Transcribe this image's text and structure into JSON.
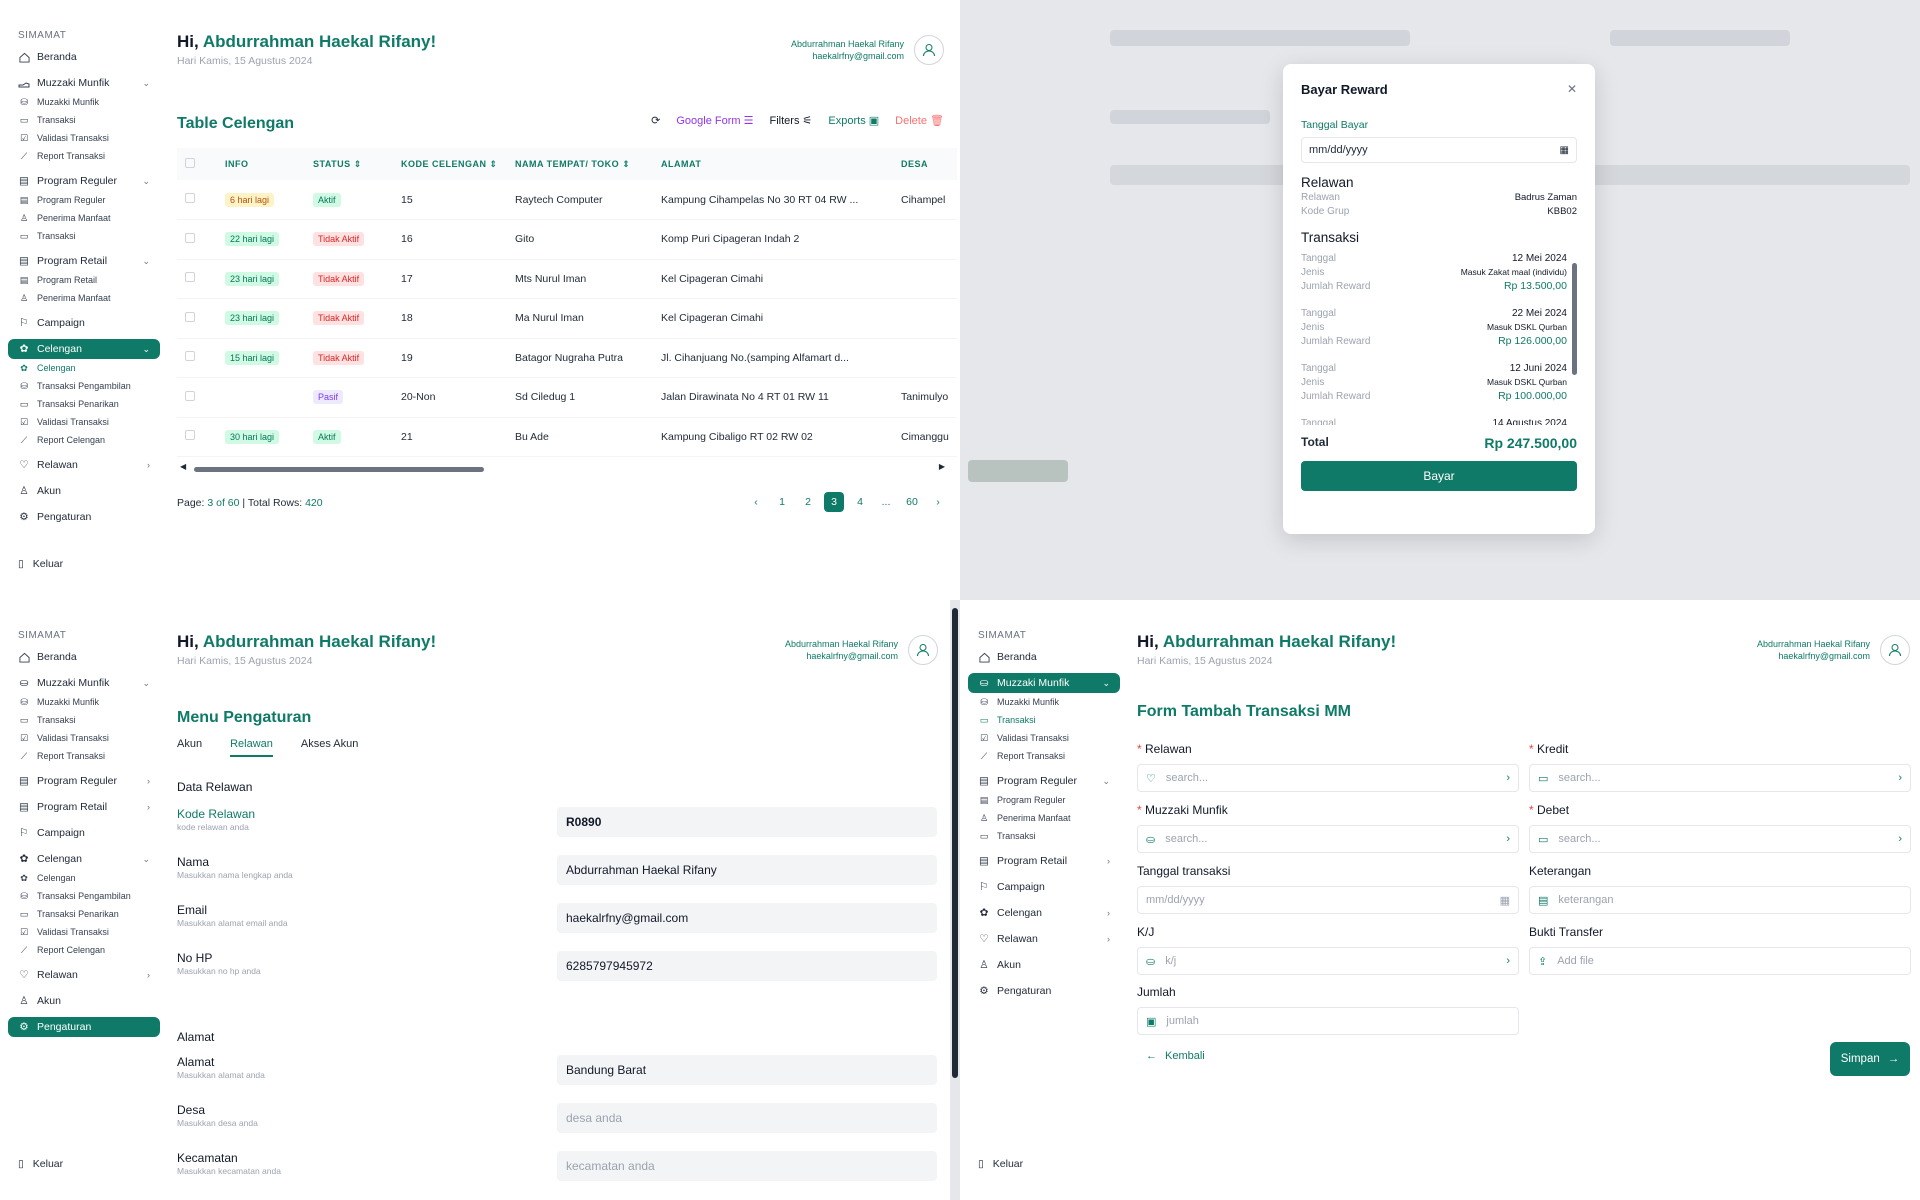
{
  "brand": "SIMAMAT",
  "header": {
    "greeting": "Hi,",
    "name": "Abdurrahman Haekal Rifany!",
    "date": "Hari Kamis, 15 Agustus 2024",
    "user_name": "Abdurrahman Haekal Rifany",
    "user_email": "haekalrfny@gmail.com"
  },
  "nav": {
    "beranda": "Beranda",
    "muzzaki": "Muzzaki Munfik",
    "muzzaki_sub": [
      "Muzakki Munfik",
      "Transaksi",
      "Validasi Transaksi",
      "Report Transaksi"
    ],
    "reguler": "Program Reguler",
    "reguler_sub": [
      "Program Reguler",
      "Penerima Manfaat",
      "Transaksi"
    ],
    "retail": "Program Retail",
    "retail_sub": [
      "Program Retail",
      "Penerima Manfaat"
    ],
    "campaign": "Campaign",
    "celengan": "Celengan",
    "celengan_sub": [
      "Celengan",
      "Transaksi Pengambilan",
      "Transaksi Penarikan",
      "Validasi Transaksi",
      "Report Celengan"
    ],
    "relawan": "Relawan",
    "akun": "Akun",
    "pengaturan": "Pengaturan",
    "keluar": "Keluar"
  },
  "table": {
    "title": "Table Celengan",
    "toolbar": {
      "google_form": "Google Form",
      "filters": "Filters",
      "exports": "Exports",
      "delete": "Delete"
    },
    "columns": [
      "INFO",
      "STATUS",
      "KODE CELENGAN",
      "NAMA TEMPAT/ TOKO",
      "ALAMAT",
      "DESA"
    ],
    "rows": [
      {
        "info": "6 hari lagi",
        "info_c": "y",
        "status": "Aktif",
        "status_c": "g",
        "kode": "15",
        "nama": "Raytech Computer",
        "alamat": "Kampung Cihampelas No 30 RT 04 RW ...",
        "desa": "Cihampel"
      },
      {
        "info": "22 hari lagi",
        "info_c": "g",
        "status": "Tidak Aktif",
        "status_c": "r",
        "kode": "16",
        "nama": "Gito",
        "alamat": "Komp Puri Cipageran Indah 2",
        "desa": ""
      },
      {
        "info": "23 hari lagi",
        "info_c": "g",
        "status": "Tidak Aktif",
        "status_c": "r",
        "kode": "17",
        "nama": "Mts Nurul Iman",
        "alamat": "Kel Cipageran Cimahi",
        "desa": ""
      },
      {
        "info": "23 hari lagi",
        "info_c": "g",
        "status": "Tidak Aktif",
        "status_c": "r",
        "kode": "18",
        "nama": "Ma Nurul Iman",
        "alamat": "Kel Cipageran Cimahi",
        "desa": ""
      },
      {
        "info": "15 hari lagi",
        "info_c": "g",
        "status": "Tidak Aktif",
        "status_c": "r",
        "kode": "19",
        "nama": "Batagor Nugraha Putra",
        "alamat": "Jl. Cihanjuang No.(samping Alfamart d...",
        "desa": ""
      },
      {
        "info": "",
        "info_c": "",
        "status": "Pasif",
        "status_c": "p",
        "kode": "20-Non",
        "nama": "Sd Ciledug 1",
        "alamat": "Jalan Dirawinata No 4 RT 01 RW 11",
        "desa": "Tanimulyo"
      },
      {
        "info": "30 hari lagi",
        "info_c": "g",
        "status": "Aktif",
        "status_c": "g",
        "kode": "21",
        "nama": "Bu Ade",
        "alamat": "Kampung Cibaligo RT 02 RW 02",
        "desa": "Cimanggu"
      }
    ],
    "page_label": "Page:",
    "page_current": "3 of 60",
    "rows_label": "| Total Rows:",
    "rows_total": "420",
    "pages": [
      "1",
      "2",
      "3",
      "4",
      "...",
      "60"
    ],
    "page_active": "3"
  },
  "modal": {
    "title": "Bayar Reward",
    "date_label": "Tanggal Bayar",
    "date_placeholder": "mm/dd/yyyy",
    "relawan_head": "Relawan",
    "relawan_k": "Relawan",
    "relawan_v": "Badrus Zaman",
    "kode_k": "Kode Grup",
    "kode_v": "KBB02",
    "tx_head": "Transaksi",
    "k_tanggal": "Tanggal",
    "k_jenis": "Jenis",
    "k_jumlah": "Jumlah Reward",
    "tx": [
      {
        "tanggal": "12 Mei 2024",
        "jenis": "Masuk Zakat maal (individu)",
        "jumlah": "Rp 13.500,00"
      },
      {
        "tanggal": "22 Mei 2024",
        "jenis": "Masuk DSKL Qurban",
        "jumlah": "Rp 126.000,00"
      },
      {
        "tanggal": "12 Juni 2024",
        "jenis": "Masuk DSKL Qurban",
        "jumlah": "Rp 100.000,00"
      },
      {
        "tanggal": "14 Agustus 2024",
        "jenis": "",
        "jumlah": ""
      }
    ],
    "total_k": "Total",
    "total_v": "Rp 247.500,00",
    "button": "Bayar"
  },
  "settings": {
    "title": "Menu Pengaturan",
    "tabs": [
      "Akun",
      "Relawan",
      "Akses Akun"
    ],
    "active_tab": "Relawan",
    "section1": "Data Relawan",
    "section2": "Alamat",
    "fields": [
      {
        "label": "Kode Relawan",
        "hint": "kode relawan anda",
        "value": "R0890"
      },
      {
        "label": "Nama",
        "hint": "Masukkan nama lengkap anda",
        "value": "Abdurrahman Haekal Rifany"
      },
      {
        "label": "Email",
        "hint": "Masukkan alamat email anda",
        "value": "haekalrfny@gmail.com"
      },
      {
        "label": "No HP",
        "hint": "Masukkan no hp anda",
        "value": "6285797945972"
      }
    ],
    "addr": [
      {
        "label": "Alamat",
        "hint": "Masukkan alamat anda",
        "value": "Bandung Barat",
        "ph": ""
      },
      {
        "label": "Desa",
        "hint": "Masukkan desa anda",
        "value": "",
        "ph": "desa anda"
      },
      {
        "label": "Kecamatan",
        "hint": "Masukkan kecamatan anda",
        "value": "",
        "ph": "kecamatan anda"
      }
    ]
  },
  "form": {
    "title": "Form Tambah Transaksi MM",
    "relawan": "Relawan",
    "kredit": "Kredit",
    "muzzaki": "Muzzaki Munfik",
    "debet": "Debet",
    "tanggal": "Tanggal transaksi",
    "keterangan": "Keterangan",
    "kj": "K/J",
    "bukti": "Bukti Transfer",
    "jumlah": "Jumlah",
    "ph_search": "search...",
    "ph_date": "mm/dd/yyyy",
    "ph_keterangan": "keterangan",
    "ph_kj": "k/j",
    "ph_file": "Add file",
    "ph_jumlah": "jumlah",
    "back": "Kembali",
    "save": "Simpan"
  },
  "colors": {
    "accent": "#0f7a67"
  }
}
